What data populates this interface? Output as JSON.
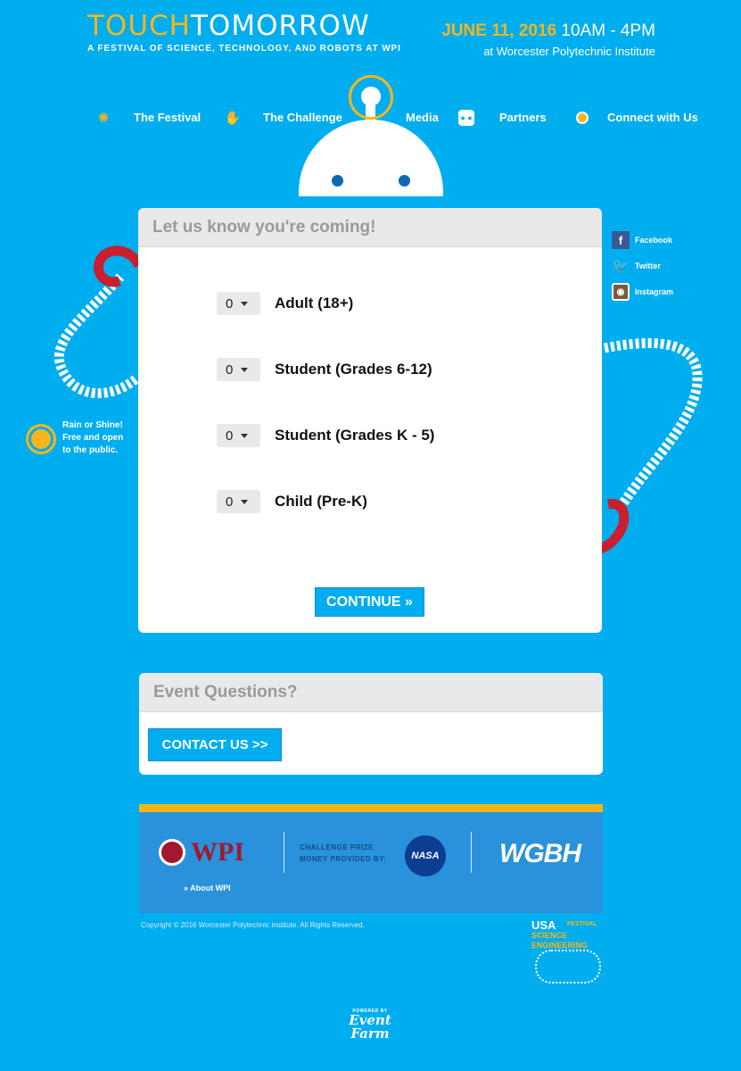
{
  "header": {
    "logo_touch": "TOUCH",
    "logo_tomorrow": "TOMORROW",
    "logo_subtitle": "A FESTIVAL OF SCIENCE, TECHNOLOGY, AND ROBOTS AT WPI",
    "date": "JUNE 11, 2016",
    "time": "10AM - 4PM",
    "location": "at Worcester Polytechnic Institute"
  },
  "nav": {
    "items": [
      {
        "label": "The Festival",
        "icon": "sun-icon"
      },
      {
        "label": "The Challenge",
        "icon": "hand-icon"
      },
      {
        "label": "Media",
        "icon": "outlet-icon"
      },
      {
        "label": "Partners",
        "icon": "sun-icon"
      },
      {
        "label": "Connect with Us",
        "icon": "none"
      }
    ]
  },
  "social": {
    "items": [
      {
        "label": "Facebook",
        "icon": "facebook-icon"
      },
      {
        "label": "Twitter",
        "icon": "twitter-icon"
      },
      {
        "label": "Instagram",
        "icon": "instagram-icon"
      }
    ]
  },
  "rain_note": {
    "line1": "Rain or Shine!",
    "line2": "Free and open",
    "line3": "to the public."
  },
  "registration": {
    "title": "Let us know you're coming!",
    "tickets": [
      {
        "qty": "0",
        "label": "Adult (18+)"
      },
      {
        "qty": "0",
        "label": "Student (Grades 6-12)"
      },
      {
        "qty": "0",
        "label": "Student (Grades K - 5)"
      },
      {
        "qty": "0",
        "label": "Child (Pre-K)"
      }
    ],
    "continue_label": "CONTINUE »"
  },
  "questions": {
    "title": "Event Questions?",
    "contact_label": "CONTACT US >>"
  },
  "footer": {
    "wpi_logo": "WPI",
    "about_link": "» About WPI",
    "prize_line1": "CHALLENGE PRIZE",
    "prize_line2": "MONEY PROVIDED BY:",
    "nasa_logo": "NASA",
    "wgbh_logo": "WGBH",
    "copyright": "Copyright © 2016 Worcester Polytechnic Institute. All Rights Reserved."
  },
  "usa_festival": {
    "line1": "USA",
    "line2": "SCIENCE",
    "line3": "ENGINEERING",
    "line4": "FESTIVAL"
  },
  "eventfarm": {
    "powered_by": "POWERED BY",
    "brand_line1": "Event",
    "brand_line2": "Farm"
  },
  "colors": {
    "background": "#00adef",
    "accent_yellow": "#f7b51b",
    "header_gray": "#e9e9e9",
    "magnet_red": "#c8202e",
    "footer_blue": "#2a92dc"
  }
}
